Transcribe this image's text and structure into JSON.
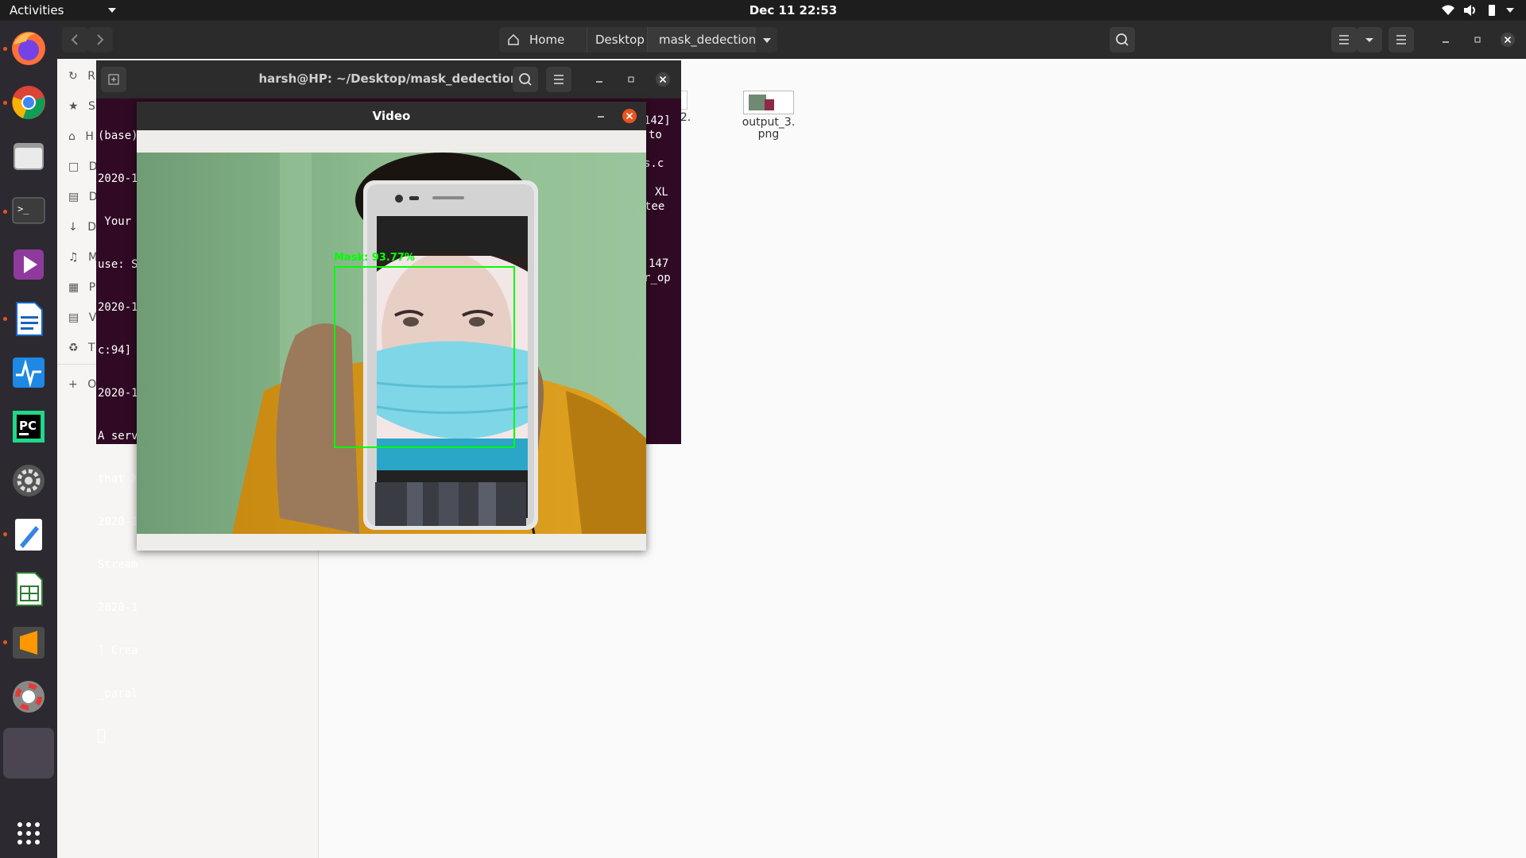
{
  "topbar": {
    "activities": "Activities",
    "clock": "Dec 11  22:53"
  },
  "dock": {
    "apps": [
      "firefox-icon",
      "chrome-icon",
      "files-icon",
      "terminal-icon",
      "media-player-icon",
      "writer-icon",
      "system-monitor-icon",
      "pycharm-icon",
      "settings-icon",
      "text-editor-icon",
      "calc-icon",
      "sublime-icon",
      "help-icon",
      "running-app-icon",
      "show-apps-icon"
    ]
  },
  "files": {
    "path": {
      "home": "Home",
      "desktop": "Desktop",
      "folder": "mask_dedection"
    },
    "sidebar": [
      "R",
      "S",
      "H",
      "D",
      "D",
      "D",
      "M",
      "P",
      "V",
      "T",
      "O"
    ],
    "items": [
      {
        "name": "_2.",
        "partial": true
      },
      {
        "name": "output_3.\npng",
        "partial": false
      }
    ]
  },
  "terminal": {
    "title": "harsh@HP: ~/Desktop/mask_dedection",
    "left_lines": [
      "(base)",
      "2020-1",
      " Your",
      "use: S",
      "2020-1",
      "c:94]",
      "2020-1",
      "A serv",
      "that X",
      "2020-1",
      "Stream",
      "2020-1",
      "] Crea",
      "_paral"
    ],
    "right_lines": [
      "142]",
      "to",
      "s.c",
      "XL",
      "tee",
      "147",
      "r_op"
    ]
  },
  "video": {
    "title": "Video",
    "detection_label": "Mask: 93.77%"
  },
  "colors": {
    "accent": "#e95420",
    "terminal_bg": "#300a24",
    "detection_box": "#00ff00"
  }
}
